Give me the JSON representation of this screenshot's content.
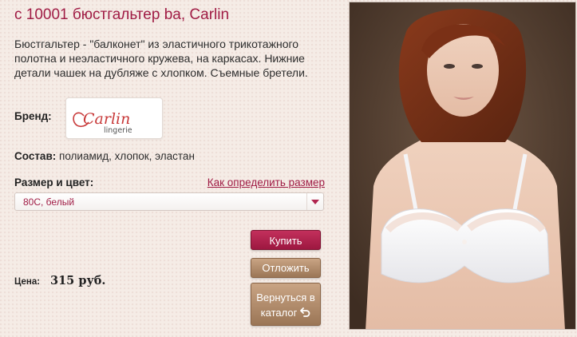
{
  "product": {
    "title": "с 10001 бюстгальтер ba, Carlin",
    "description": "Бюстгальтер - \"балконет\" из эластичного трикотажного полотна и неэластичного кружева, на каркасах. Нижние детали чашек на дубляже с хлопком. Съемные бретели.",
    "brand_label": "Бренд:",
    "brand_logo": {
      "name": "Carlin",
      "sub": "lingerie"
    },
    "composition_label": "Состав:",
    "composition_value": "полиамид, хлопок, эластан",
    "size_color_label": "Размер и цвет:",
    "size_guide_link": "Как определить размер",
    "size_select": {
      "selected": "80C, белый"
    },
    "price_label": "Цена:",
    "price_value": "315 руб."
  },
  "actions": {
    "buy": "Купить",
    "postpone": "Отложить",
    "back_line1": "Вернуться в",
    "back_line2": "каталог"
  },
  "colors": {
    "accent": "#a01c45",
    "button_brown": "#b08b6a",
    "background": "#f5ece6"
  }
}
